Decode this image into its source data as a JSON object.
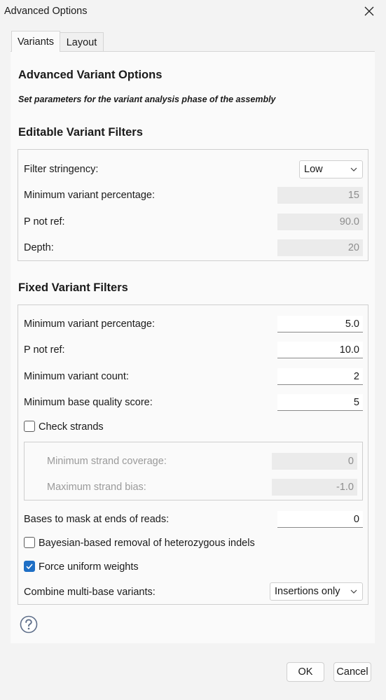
{
  "window": {
    "title": "Advanced Options"
  },
  "tabs": [
    {
      "label": "Variants",
      "active": true
    },
    {
      "label": "Layout",
      "active": false
    }
  ],
  "page": {
    "heading": "Advanced Variant Options",
    "subtitle": "Set parameters for the variant analysis phase of the assembly"
  },
  "editable": {
    "heading": "Editable Variant Filters",
    "filter_stringency": {
      "label": "Filter stringency:",
      "value": "Low"
    },
    "min_variant_pct": {
      "label": "Minimum variant percentage:",
      "value": "15"
    },
    "p_not_ref": {
      "label": "P not ref:",
      "value": "90.0"
    },
    "depth": {
      "label": "Depth:",
      "value": "20"
    }
  },
  "fixed": {
    "heading": "Fixed Variant Filters",
    "min_variant_pct": {
      "label": "Minimum variant percentage:",
      "value": "5.0"
    },
    "p_not_ref": {
      "label": "P not ref:",
      "value": "10.0"
    },
    "min_variant_count": {
      "label": "Minimum variant count:",
      "value": "2"
    },
    "min_base_quality": {
      "label": "Minimum base quality score:",
      "value": "5"
    },
    "check_strands": {
      "label": "Check strands",
      "checked": false
    },
    "min_strand_coverage": {
      "label": "Minimum strand coverage:",
      "value": "0"
    },
    "max_strand_bias": {
      "label": "Maximum strand bias:",
      "value": "-1.0"
    },
    "bases_to_mask": {
      "label": "Bases to mask at ends of reads:",
      "value": "0"
    },
    "bayesian_removal": {
      "label": "Bayesian-based removal of heterozygous indels",
      "checked": false
    },
    "force_uniform": {
      "label": "Force uniform weights",
      "checked": true
    },
    "combine_multi_base": {
      "label": "Combine multi-base variants:",
      "value": "Insertions only"
    }
  },
  "buttons": {
    "ok": "OK",
    "cancel": "Cancel"
  },
  "colors": {
    "accent": "#1f6fc5",
    "panel": "#fafafa",
    "window": "#f3f3f3"
  }
}
